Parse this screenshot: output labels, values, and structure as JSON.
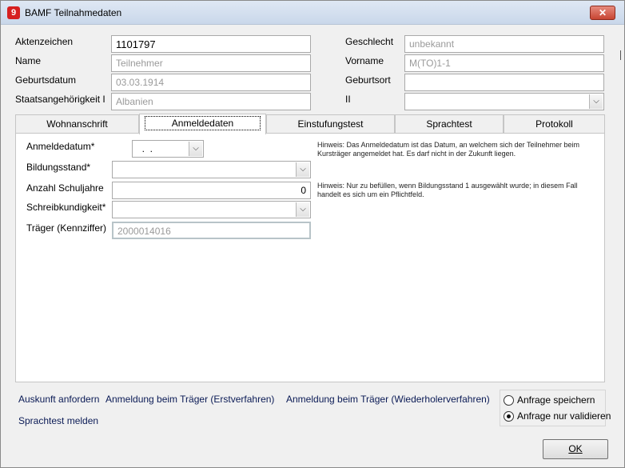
{
  "window": {
    "title": "BAMF Teilnahmedaten",
    "close_glyph": "✕",
    "app_icon_text": "9"
  },
  "person": {
    "aktenzeichen_label": "Aktenzeichen",
    "aktenzeichen_value": "1101797",
    "geschlecht_label": "Geschlecht",
    "geschlecht_value": "unbekannt",
    "name_label": "Name",
    "name_value": "Teilnehmer",
    "vorname_label": "Vorname",
    "vorname_value": "M(TO)1-1",
    "geburtsdatum_label": "Geburtsdatum",
    "geburtsdatum_value": "03.03.1914",
    "geburtsort_label": "Geburtsort",
    "geburtsort_value": "",
    "staat_label": "Staatsangehörigkeit I",
    "staat_value": "Albanien",
    "ii_label": "II",
    "ii_value": ""
  },
  "tabs": [
    {
      "label": "Wohnanschrift"
    },
    {
      "label": "Anmeldedaten"
    },
    {
      "label": "Einstufungstest"
    },
    {
      "label": "Sprachtest"
    },
    {
      "label": "Protokoll"
    }
  ],
  "anmeldedaten": {
    "datum_label": "Anmeldedatum*",
    "datum_value": "  .  .",
    "bildung_label": "Bildungsstand*",
    "bildung_value": "",
    "schuljahre_label": "Anzahl Schuljahre",
    "schuljahre_value": "0",
    "schreib_label": "Schreibkundigkeit*",
    "schreib_value": "",
    "traeger_label": "Träger (Kennziffer)",
    "traeger_value": "2000014016",
    "hint1": "Hinweis: Das Anmeldedatum ist das Datum, an welchem sich der Teilnehmer beim Kursträger angemeldet hat. Es darf nicht in der Zukunft liegen.",
    "hint2": "Hinweis: Nur zu befüllen, wenn Bildungsstand 1 ausgewählt wurde; in diesem Fall handelt es sich um ein Pflichtfeld."
  },
  "actions": {
    "auskunft": "Auskunft anfordern",
    "erstverfahren": "Anmeldung beim Träger (Erstverfahren)",
    "wiederholer": "Anmeldung beim Träger (Wiederholerverfahren)",
    "sprachtest": "Sprachtest melden"
  },
  "radios": [
    {
      "label": "Anfrage speichern",
      "checked": false
    },
    {
      "label": "Anfrage nur validieren",
      "checked": true
    }
  ],
  "ok_label": "OK",
  "dropdown_glyph": "⌵"
}
